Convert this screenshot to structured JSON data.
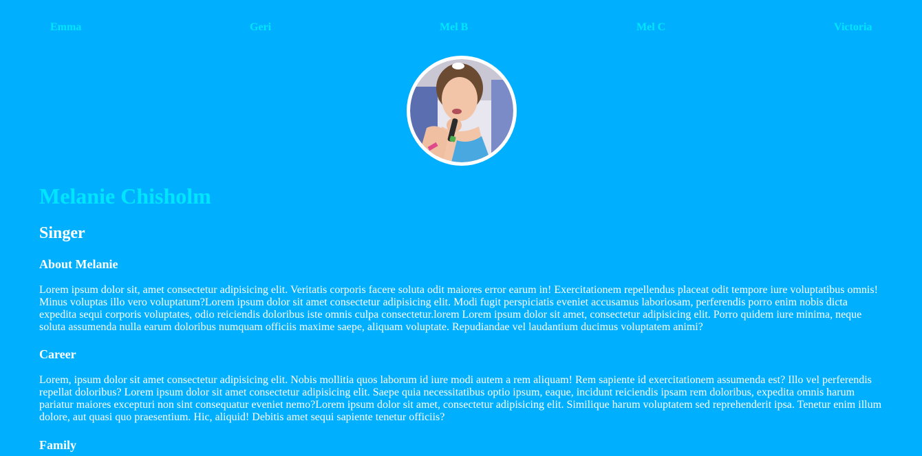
{
  "nav": {
    "items": [
      {
        "label": "Emma"
      },
      {
        "label": "Geri"
      },
      {
        "label": "Mel B"
      },
      {
        "label": "Mel C"
      },
      {
        "label": "Victoria"
      }
    ]
  },
  "profile": {
    "name": "Melanie Chisholm",
    "role": "Singer"
  },
  "sections": {
    "about": {
      "heading": "About Melanie",
      "text": "Lorem ipsum dolor sit, amet consectetur adipisicing elit. Veritatis corporis facere soluta odit maiores error earum in! Exercitationem repellendus placeat odit tempore iure voluptatibus omnis! Minus voluptas illo vero voluptatum?Lorem ipsum dolor sit amet consectetur adipisicing elit. Modi fugit perspiciatis eveniet accusamus laboriosam, perferendis porro enim nobis dicta expedita sequi corporis voluptates, odio reiciendis doloribus iste omnis culpa consectetur.lorem Lorem ipsum dolor sit amet, consectetur adipisicing elit. Porro quidem iure minima, neque soluta assumenda nulla earum doloribus numquam officiis maxime saepe, aliquam voluptate. Repudiandae vel laudantium ducimus voluptatem animi?"
    },
    "career": {
      "heading": "Career",
      "text": "Lorem, ipsum dolor sit amet consectetur adipisicing elit. Nobis mollitia quos laborum id iure modi autem a rem aliquam! Rem sapiente id exercitationem assumenda est? Illo vel perferendis repellat doloribus? Lorem ipsum dolor sit amet consectetur adipisicing elit. Saepe quia necessitatibus optio ipsum, eaque, incidunt reiciendis ipsam rem doloribus, expedita omnis harum pariatur maiores excepturi non sint consequatur eveniet nemo?Lorem ipsum dolor sit amet, consectetur adipisicing elit. Similique harum voluptatem sed reprehenderit ipsa. Tenetur enim illum dolore, aut quasi quo praesentium. Hic, aliquid! Debitis amet sequi sapiente tenetur officiis?"
    },
    "family": {
      "heading": "Family"
    }
  },
  "colors": {
    "background": "#00b0ff",
    "accent": "#00e5ff",
    "text": "#ffffff"
  }
}
